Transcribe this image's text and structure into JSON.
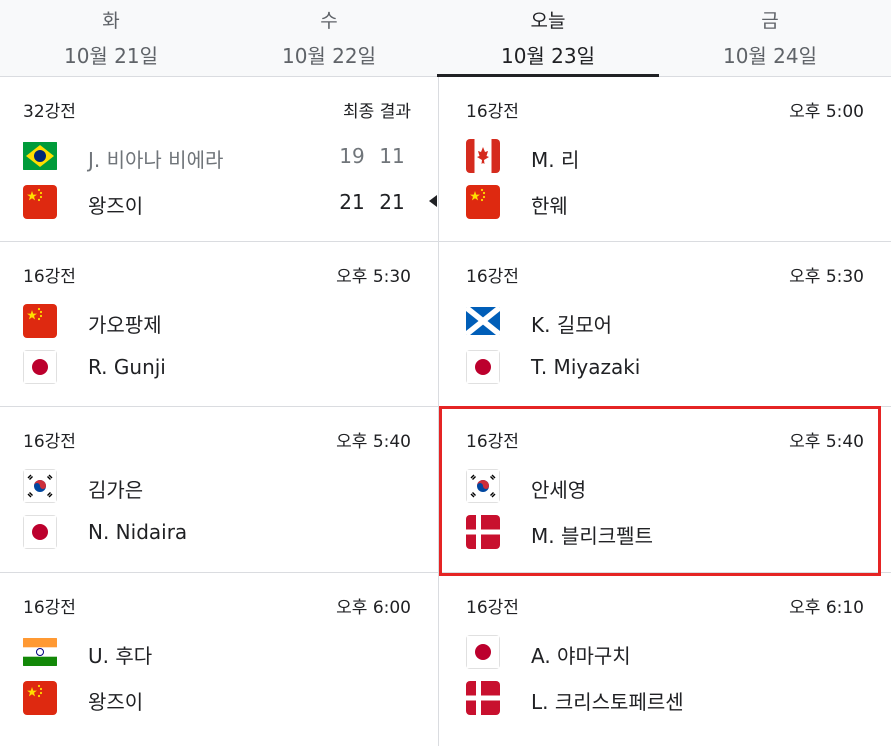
{
  "tabs": [
    {
      "dow": "화",
      "date": "10월 21일",
      "active": false
    },
    {
      "dow": "수",
      "date": "10월 22일",
      "active": false
    },
    {
      "dow": "오늘",
      "date": "10월 23일",
      "active": true
    },
    {
      "dow": "금",
      "date": "10월 24일",
      "active": false
    }
  ],
  "matches": {
    "m1": {
      "stage": "32강전",
      "status": "최종 결과",
      "p1": {
        "name": "J. 비아나 비에라",
        "flag": "brazil-flag",
        "scores": [
          "19",
          "11"
        ]
      },
      "p2": {
        "name": "왕즈이",
        "flag": "china-flag",
        "scores": [
          "21",
          "21"
        ]
      }
    },
    "m2": {
      "stage": "16강전",
      "status": "오후 5:00",
      "p1": {
        "name": "M. 리",
        "flag": "canada-flag"
      },
      "p2": {
        "name": "한웨",
        "flag": "china-flag"
      }
    },
    "m3": {
      "stage": "16강전",
      "status": "오후 5:30",
      "p1": {
        "name": "가오팡제",
        "flag": "china-flag"
      },
      "p2": {
        "name": "R. Gunji",
        "flag": "japan-flag"
      }
    },
    "m4": {
      "stage": "16강전",
      "status": "오후 5:30",
      "p1": {
        "name": "K. 길모어",
        "flag": "scotland-flag"
      },
      "p2": {
        "name": "T. Miyazaki",
        "flag": "japan-flag"
      }
    },
    "m5": {
      "stage": "16강전",
      "status": "오후 5:40",
      "p1": {
        "name": "김가은",
        "flag": "korea-flag"
      },
      "p2": {
        "name": "N. Nidaira",
        "flag": "japan-flag"
      }
    },
    "m6": {
      "stage": "16강전",
      "status": "오후 5:40",
      "p1": {
        "name": "안세영",
        "flag": "korea-flag"
      },
      "p2": {
        "name": "M. 블리크펠트",
        "flag": "denmark-flag"
      }
    },
    "m7": {
      "stage": "16강전",
      "status": "오후 6:00",
      "p1": {
        "name": "U. 후다",
        "flag": "india-flag"
      },
      "p2": {
        "name": "왕즈이",
        "flag": "china-flag"
      }
    },
    "m8": {
      "stage": "16강전",
      "status": "오후 6:10",
      "p1": {
        "name": "A. 야마구치",
        "flag": "japan-flag"
      },
      "p2": {
        "name": "L. 크리스토페르센",
        "flag": "denmark-flag"
      }
    }
  },
  "colors": {
    "highlight": "#e52424",
    "text": "#202124",
    "muted": "#70757a"
  }
}
